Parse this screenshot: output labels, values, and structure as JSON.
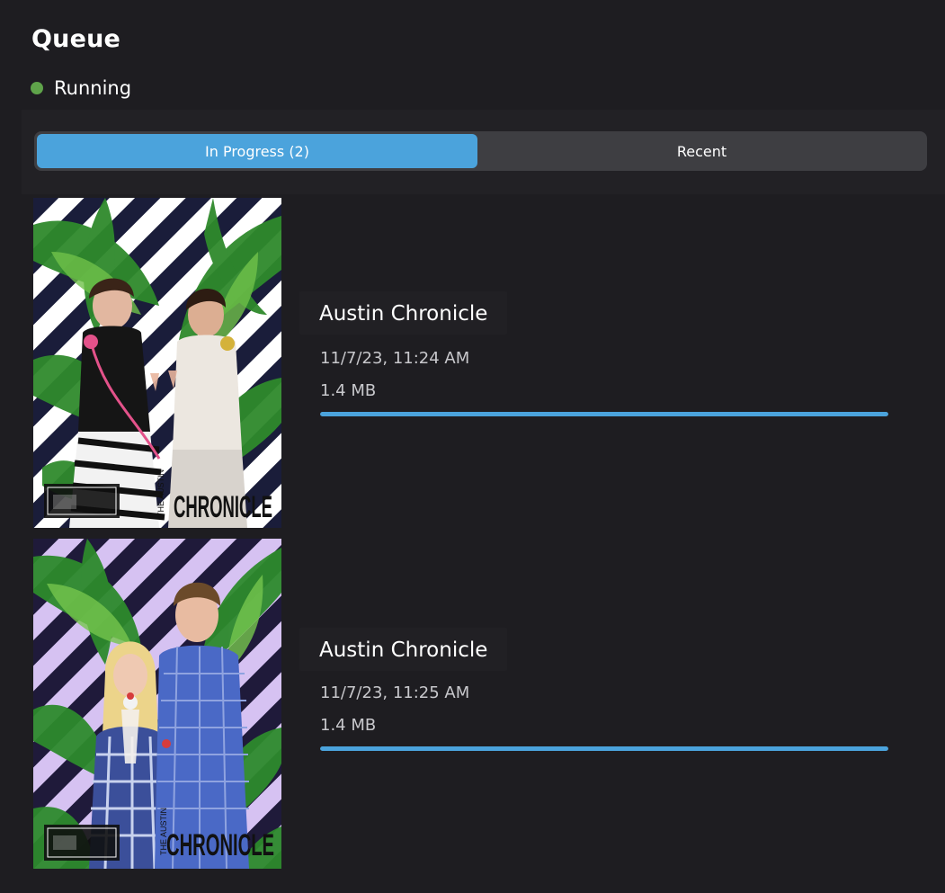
{
  "page": {
    "title": "Queue"
  },
  "status": {
    "label": "Running",
    "color": "#5fa34a"
  },
  "tabs": [
    {
      "label": "In Progress (2)",
      "active": true
    },
    {
      "label": "Recent",
      "active": false
    }
  ],
  "accent_color": "#4ba3dc",
  "queue_items": [
    {
      "title": "Austin Chronicle",
      "date": "11/7/23, 11:24 AM",
      "size": "1.4 MB",
      "progress": 1.0,
      "thumbnail_logo": "CHRONICLE",
      "thumbnail_logo_small": "THE AUSTIN"
    },
    {
      "title": "Austin Chronicle",
      "date": "11/7/23, 11:25 AM",
      "size": "1.4 MB",
      "progress": 1.0,
      "thumbnail_logo": "CHRONICLE",
      "thumbnail_logo_small": "THE AUSTIN"
    }
  ]
}
